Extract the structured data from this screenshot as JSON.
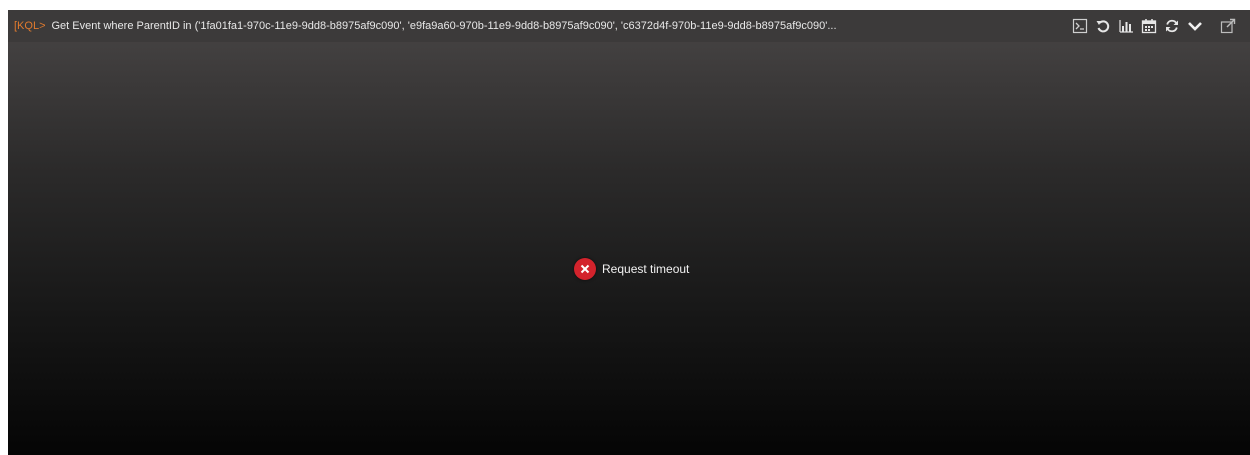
{
  "query_bar": {
    "prompt": "[KQL>",
    "text": "Get Event where ParentID in ('1fa01fa1-970c-11e9-9dd8-b8975af9c090', 'e9fa9a60-970b-11e9-9dd8-b8975af9c090', 'c6372d4f-970b-11e9-9dd8-b8975af9c090'..."
  },
  "toolbar": {
    "icons": [
      "terminal-icon",
      "undo-icon",
      "bar-chart-icon",
      "calendar-icon",
      "refresh-icon",
      "chevron-down-icon",
      "external-link-icon"
    ]
  },
  "message": {
    "text": "Request timeout",
    "status_color": "#d3232c"
  },
  "colors": {
    "prompt": "#e07a2e",
    "topbar": "#3c3a3a"
  }
}
